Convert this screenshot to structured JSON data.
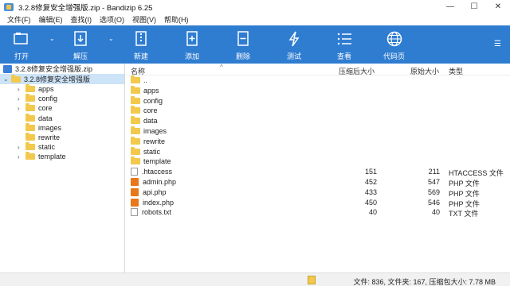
{
  "window": {
    "title": "3.2.8修复安全增强版.zip - Bandizip 6.25",
    "min_glyph": "—",
    "max_glyph": "☐",
    "close_glyph": "✕"
  },
  "menu": [
    "文件(F)",
    "编辑(E)",
    "查找(I)",
    "选项(O)",
    "视图(V)",
    "帮助(H)"
  ],
  "toolbar": {
    "open": "打开",
    "extract": "解压",
    "new": "新建",
    "add": "添加",
    "delete": "删除",
    "test": "测试",
    "view": "查看",
    "codepage": "代码页"
  },
  "tree": {
    "root": "3.2.8修复安全增强版.zip",
    "selected": "3.2.8修复安全增强版",
    "folders": [
      "apps",
      "config",
      "core",
      "data",
      "images",
      "rewrite",
      "static",
      "template"
    ]
  },
  "list": {
    "headers": {
      "name": "名称",
      "size": "压缩后大小",
      "orig": "原始大小",
      "type": "类型"
    },
    "rows": [
      {
        "name": "..",
        "size": "",
        "orig": "",
        "type": ""
      },
      {
        "name": "apps",
        "size": "",
        "orig": "",
        "type": ""
      },
      {
        "name": "config",
        "size": "",
        "orig": "",
        "type": ""
      },
      {
        "name": "core",
        "size": "",
        "orig": "",
        "type": ""
      },
      {
        "name": "data",
        "size": "",
        "orig": "",
        "type": ""
      },
      {
        "name": "images",
        "size": "",
        "orig": "",
        "type": ""
      },
      {
        "name": "rewrite",
        "size": "",
        "orig": "",
        "type": ""
      },
      {
        "name": "static",
        "size": "",
        "orig": "",
        "type": ""
      },
      {
        "name": "template",
        "size": "",
        "orig": "",
        "type": ""
      },
      {
        "name": ".htaccess",
        "size": "151",
        "orig": "211",
        "type": "HTACCESS 文件"
      },
      {
        "name": "admin.php",
        "size": "452",
        "orig": "547",
        "type": "PHP 文件"
      },
      {
        "name": "api.php",
        "size": "433",
        "orig": "569",
        "type": "PHP 文件"
      },
      {
        "name": "index.php",
        "size": "450",
        "orig": "546",
        "type": "PHP 文件"
      },
      {
        "name": "robots.txt",
        "size": "40",
        "orig": "40",
        "type": "TXT 文件"
      }
    ]
  },
  "status": {
    "text": "文件: 836, 文件夹: 167, 压缩包大小: 7.78 MB"
  },
  "colors": {
    "toolbar": "#2f7dd1",
    "selection": "#cde3f7",
    "folder": "#f2c94c"
  }
}
